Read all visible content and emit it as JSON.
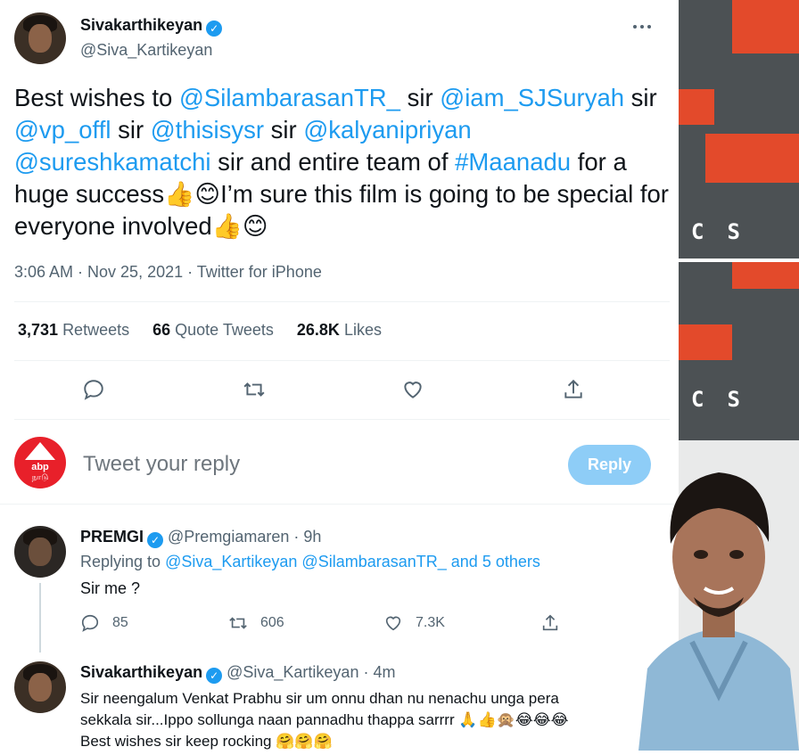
{
  "tweet": {
    "author_name": "Sivakarthikeyan",
    "author_handle": "@Siva_Kartikeyan",
    "more_icon": "more-horizontal-icon",
    "text_parts": [
      {
        "t": "Best wishes to ",
        "link": false
      },
      {
        "t": "@SilambarasanTR_",
        "link": true
      },
      {
        "t": " sir ",
        "link": false
      },
      {
        "t": "@iam_SJSuryah",
        "link": true
      },
      {
        "t": " sir ",
        "link": false
      },
      {
        "t": "@vp_offl",
        "link": true
      },
      {
        "t": " sir ",
        "link": false
      },
      {
        "t": "@thisisysr",
        "link": true
      },
      {
        "t": " sir ",
        "link": false
      },
      {
        "t": "@kalyanipriyan",
        "link": true
      },
      {
        "t": " ",
        "link": false
      },
      {
        "t": "@sureshkamatchi",
        "link": true
      },
      {
        "t": " sir and entire team of ",
        "link": false
      },
      {
        "t": "#Maanadu",
        "link": true
      },
      {
        "t": " for a huge success👍😊I’m sure this film is going to be special for everyone involved👍😊",
        "link": false
      }
    ],
    "meta_time": "3:06 AM · Nov 25, 2021 · Twitter for iPhone",
    "stats": {
      "retweets_count": "3,731",
      "retweets_label": "Retweets",
      "quotes_count": "66",
      "quotes_label": "Quote Tweets",
      "likes_count": "26.8K",
      "likes_label": "Likes"
    }
  },
  "compose": {
    "avatar_brand": "abp",
    "avatar_sub": "நாடு",
    "placeholder": "Tweet your reply",
    "reply_button": "Reply"
  },
  "replies": [
    {
      "name": "PREMGI",
      "handle": "@Premgiamaren",
      "time": "· 9h",
      "replying_prefix": "Replying to",
      "replying_links": "@Siva_Kartikeyan @SilambarasanTR_",
      "replying_suffix": "and 5 others",
      "text": "Sir me ?",
      "reply_count": "85",
      "retweet_count": "606",
      "like_count": "7.3K"
    },
    {
      "name": "Sivakarthikeyan",
      "handle": "@Siva_Kartikeyan",
      "time": "· 4m",
      "line1": "Sir neengalum Venkat Prabhu sir um onnu dhan nu nenachu unga pera",
      "line2": "sekkala sir...Ippo sollunga naan pannadhu thappa sarrrr 🙏👍🙊😂😂😂",
      "line3": "Best wishes sir keep rocking 🤗🤗🤗"
    }
  ],
  "poster": {
    "letters": "CS"
  },
  "colors": {
    "link": "#1d9bf0",
    "muted": "#536471",
    "reply_button": "#8ecdf7",
    "poster_red": "#e34a2b",
    "poster_grey": "#4c5154"
  }
}
